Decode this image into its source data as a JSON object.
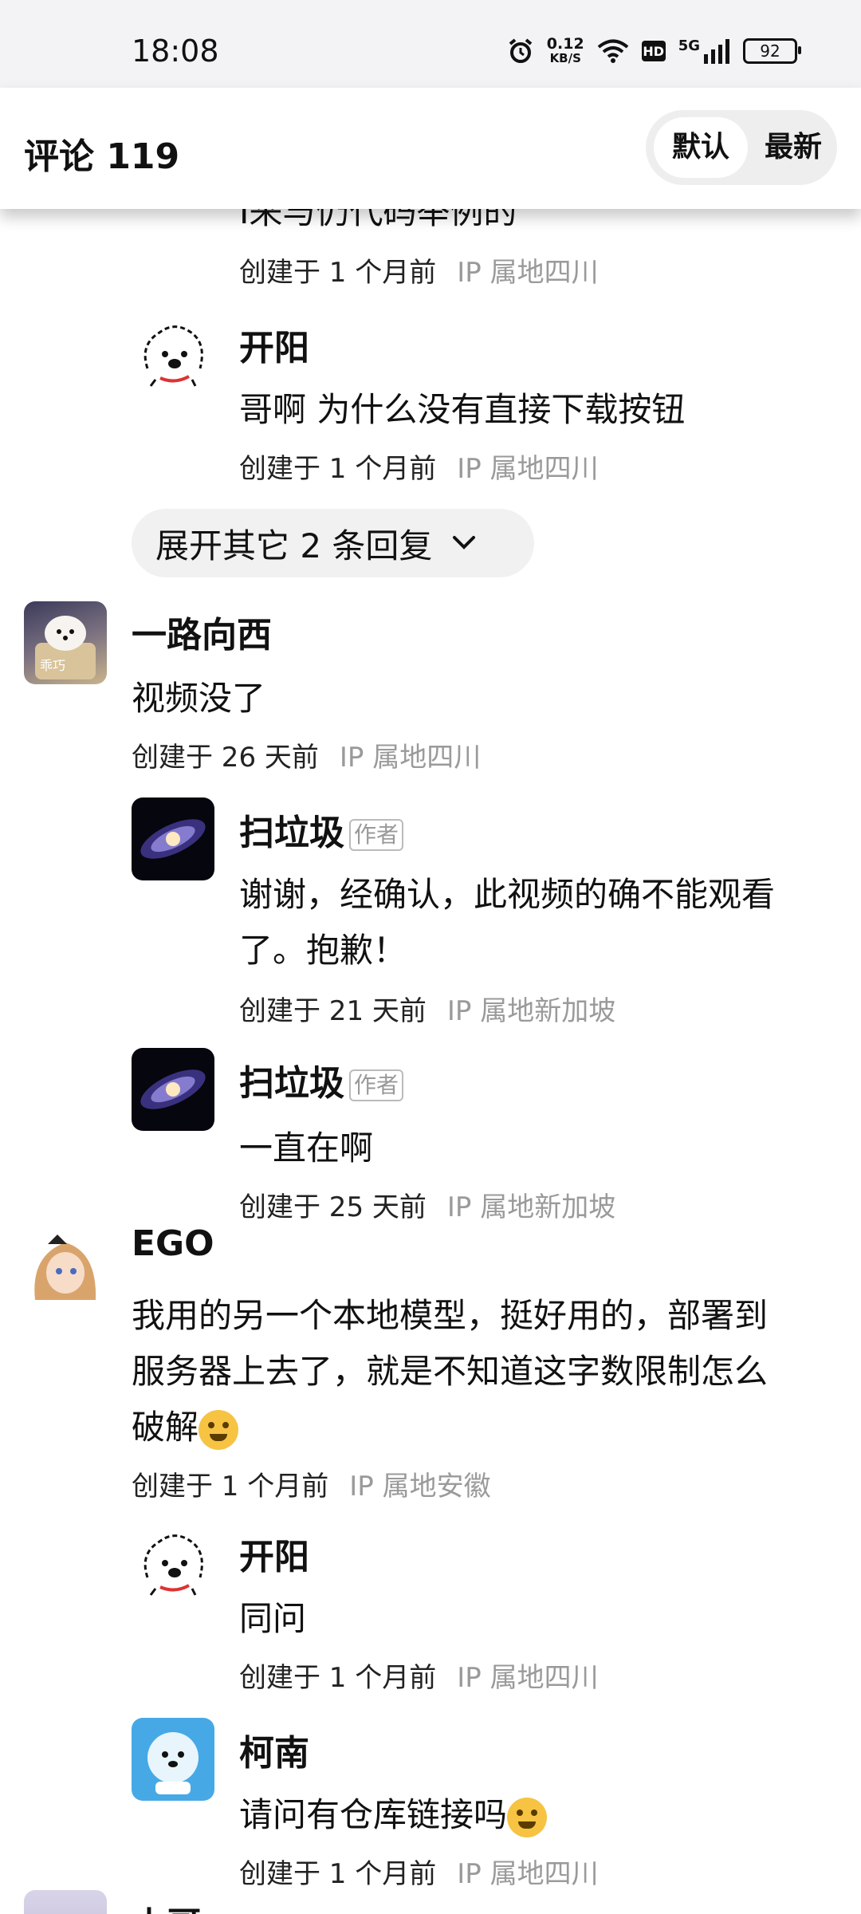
{
  "status_bar": {
    "time": "18:08",
    "net_speed_value": "0.12",
    "net_speed_unit": "KB/S",
    "hd": "HD",
    "network": "5G",
    "battery": "92"
  },
  "header": {
    "title": "评论 119",
    "sort_default": "默认",
    "sort_latest": "最新"
  },
  "partial_text": "I来与仍代码举例的",
  "expand_label": "展开其它 2 条回复",
  "comments": [
    {
      "name": "开阳",
      "text": "哥啊 为什么没有直接下载按钮",
      "time": "创建于 1 个月前",
      "ip": "IP 属地四川"
    },
    {
      "name": "一路向西",
      "text": "视频没了",
      "time": "创建于 26 天前",
      "ip": "IP 属地四川",
      "avatar_text": "乖巧"
    },
    {
      "name": "扫垃圾",
      "tag": "作者",
      "text1": "谢谢，经确认，此视频的确不能观看",
      "text2": "了。抱歉！",
      "time": "创建于 21 天前",
      "ip": "IP 属地新加坡"
    },
    {
      "name": "扫垃圾",
      "tag": "作者",
      "text": "一直在啊",
      "time": "创建于 25 天前",
      "ip": "IP 属地新加坡"
    },
    {
      "name": "EGO",
      "text1": "我用的另一个本地模型，挺好用的，部署到",
      "text2": "服务器上去了，就是不知道这字数限制怎么",
      "text3": "破解",
      "time": "创建于 1 个月前",
      "ip": "IP 属地安徽"
    },
    {
      "name": "开阳",
      "text": "同问",
      "time": "创建于 1 个月前",
      "ip": "IP 属地四川"
    },
    {
      "name": "柯南",
      "text": "请问有仓库链接吗",
      "time": "创建于 1 个月前",
      "ip": "IP 属地四川"
    },
    {
      "name": "木哥"
    }
  ],
  "first_meta": {
    "time": "创建于 1 个月前",
    "ip": "IP 属地四川"
  },
  "colors": {
    "header_bg": "#ffffff",
    "status_bar_bg": "#f3f3f5",
    "meta_ip": "#9a9a9a",
    "expand_bg": "#f1f1f2"
  }
}
